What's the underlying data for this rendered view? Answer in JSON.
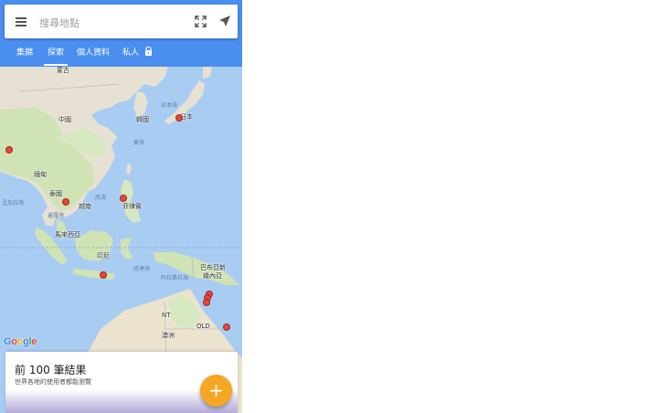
{
  "search": {
    "placeholder": "搜尋地點"
  },
  "icons": {
    "menu": "menu-icon",
    "expand": "fullscreen-icon",
    "navigate": "navigation-arrow-icon",
    "lock": "lock-icon",
    "add": "plus-icon"
  },
  "tabs": [
    {
      "label": "集錦"
    },
    {
      "label": "探索"
    },
    {
      "label": "個人資料"
    },
    {
      "label": "私人"
    }
  ],
  "active_tab": "探索",
  "map_labels": {
    "mongolia": "蒙古",
    "china": "中國",
    "korea": "韓國",
    "japan": "日本",
    "sea_of_japan": "日本海",
    "east_sea": "東海",
    "myanmar": "緬甸",
    "thailand": "泰國",
    "vietnam": "越南",
    "south_sea": "南海",
    "philippines": "菲律賓",
    "bay_of_bengal": "孟加拉灣",
    "gulf_of_thailand": "暹羅灣",
    "malaysia": "馬來西亞",
    "indonesia": "印尼",
    "banda_sea": "班達海",
    "arafura_sea": "阿拉弗拉海",
    "png": "巴布亞新幾內亞",
    "png_line1": "巴布亞新",
    "png_line2": "幾內亞",
    "nt": "NT",
    "qld": "QLD",
    "australia": "澳洲"
  },
  "google_logo": {
    "letters": [
      "G",
      "o",
      "o",
      "g",
      "l",
      "e"
    ],
    "colors": [
      "#4285F4",
      "#EA4335",
      "#FBBC05",
      "#4285F4",
      "#34A853",
      "#EA4335"
    ]
  },
  "card": {
    "title": "前 100 筆結果",
    "subtitle": "世界各地的使用者都能瀏覽"
  },
  "fab": {
    "label": "+"
  },
  "colors": {
    "header": "#4a8ef0",
    "water": "#a9cdf2",
    "land": "#eae6da",
    "pin": "#e8453c",
    "fab": "#f5a623"
  }
}
